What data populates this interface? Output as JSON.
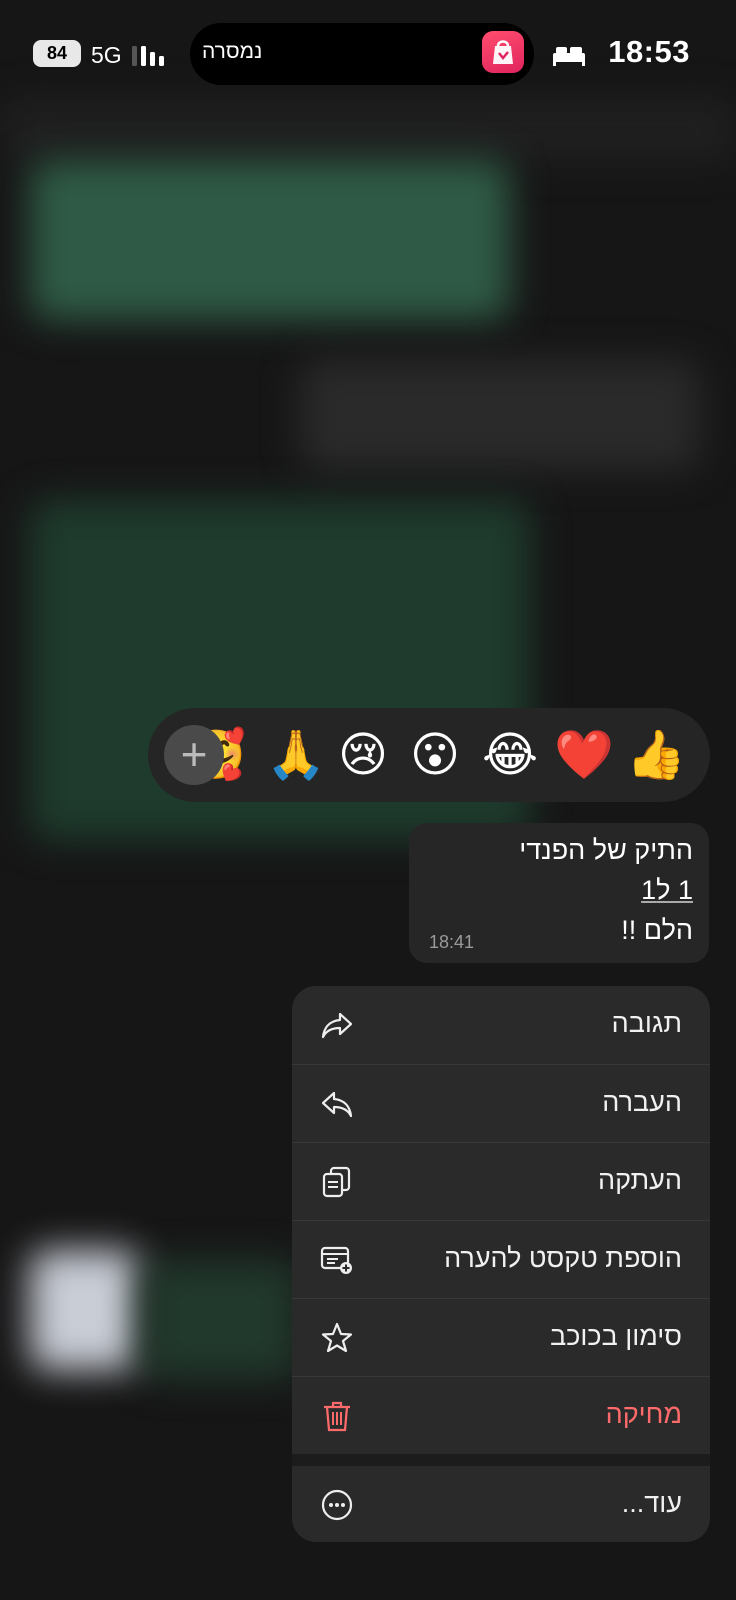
{
  "status_bar": {
    "time": "18:53",
    "pill_label": "נמסרה",
    "battery": "84",
    "network": "5G"
  },
  "reactions": {
    "emojis": [
      "👍",
      "❤️",
      "😂",
      "😮",
      "😢",
      "🙏",
      "🥰"
    ],
    "more": "+"
  },
  "message": {
    "lines": [
      "התיק של הפנדי",
      "1 ל1",
      "הלם !!"
    ],
    "time": "18:41"
  },
  "context_menu": {
    "items": [
      {
        "label": "תגובה",
        "icon": "reply-arrow-icon"
      },
      {
        "label": "העברה",
        "icon": "forward-arrow-icon"
      },
      {
        "label": "העתקה",
        "icon": "copy-icon"
      },
      {
        "label": "הוספת טקסט להערה",
        "icon": "add-note-icon"
      },
      {
        "label": "סימון בכוכב",
        "icon": "star-icon"
      },
      {
        "label": "מחיקה",
        "icon": "trash-icon",
        "color": "#ff6b6b"
      },
      {
        "label": "עוד...",
        "icon": "more-icon"
      }
    ]
  }
}
